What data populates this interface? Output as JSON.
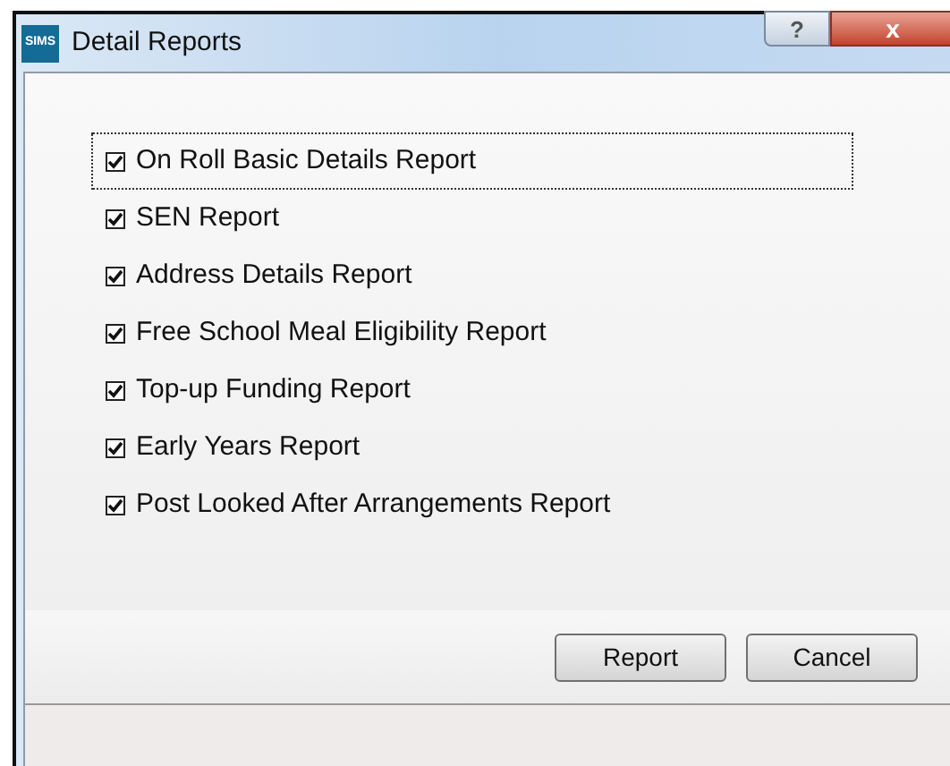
{
  "window": {
    "app_badge": "SIMS",
    "title": "Detail Reports",
    "help_button": "?",
    "close_button": "x"
  },
  "reports": [
    {
      "label": "On Roll Basic Details Report",
      "checked": true,
      "focused": true
    },
    {
      "label": "SEN Report",
      "checked": true,
      "focused": false
    },
    {
      "label": "Address Details Report",
      "checked": true,
      "focused": false
    },
    {
      "label": "Free School Meal Eligibility Report",
      "checked": true,
      "focused": false
    },
    {
      "label": "Top-up Funding Report",
      "checked": true,
      "focused": false
    },
    {
      "label": "Early Years Report",
      "checked": true,
      "focused": false
    },
    {
      "label": "Post Looked After Arrangements Report",
      "checked": true,
      "focused": false
    }
  ],
  "buttons": [
    "Report",
    "Cancel"
  ]
}
